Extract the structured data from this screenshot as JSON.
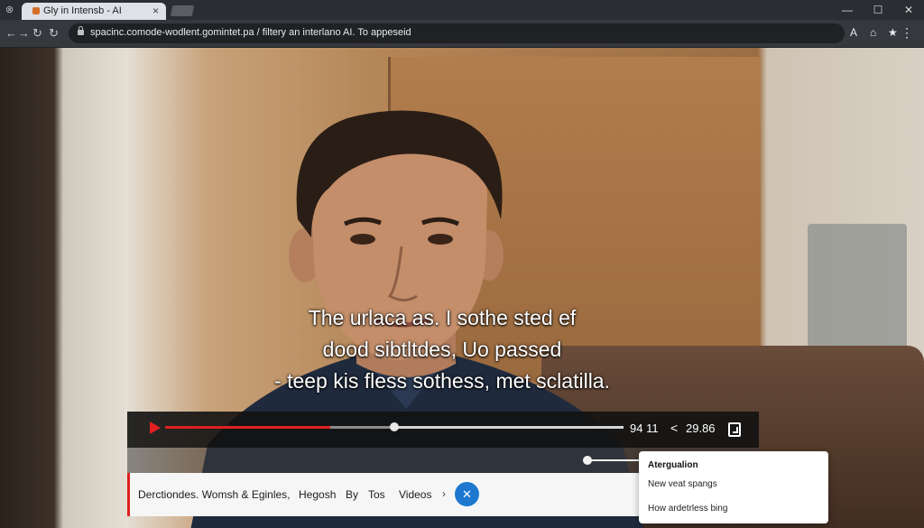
{
  "browser": {
    "tab_title": "Gly in Intensb - AI",
    "tab_close": "×",
    "url": "spacinc.comode-wodlent.gomintet.pa / filtery an interlano AI. To appeseid",
    "icons": {
      "back": "←",
      "forward": "→",
      "reload": "↻",
      "secure": "lock-icon",
      "reader": "A",
      "home": "⌂",
      "bookmark": "★",
      "menu": "⋮",
      "minimize": "—",
      "maximize": "☐",
      "close": "✕"
    }
  },
  "video": {
    "subtitle_lines": [
      "The urlaca as. I sothe sted ef",
      "dood sibtltdes, Uo passed",
      "- teep kis fless sothess, met sclatilla."
    ],
    "progress_fraction": 0.36,
    "buffered_fraction": 0.5,
    "time_elapsed": "94 11",
    "time_total": "29.86",
    "accent_color": "#e02020"
  },
  "bottom_bar": {
    "items": [
      "Derctiondes. Womsh & Eginles,",
      "Hegosh",
      "By",
      "Tos",
      "Videos"
    ],
    "chevron": "›",
    "close_label": "✕",
    "close_color": "#1e78d0"
  },
  "popup": {
    "title": "Atergualion",
    "items": [
      "New veat spangs",
      "How ardetrless bing"
    ]
  }
}
